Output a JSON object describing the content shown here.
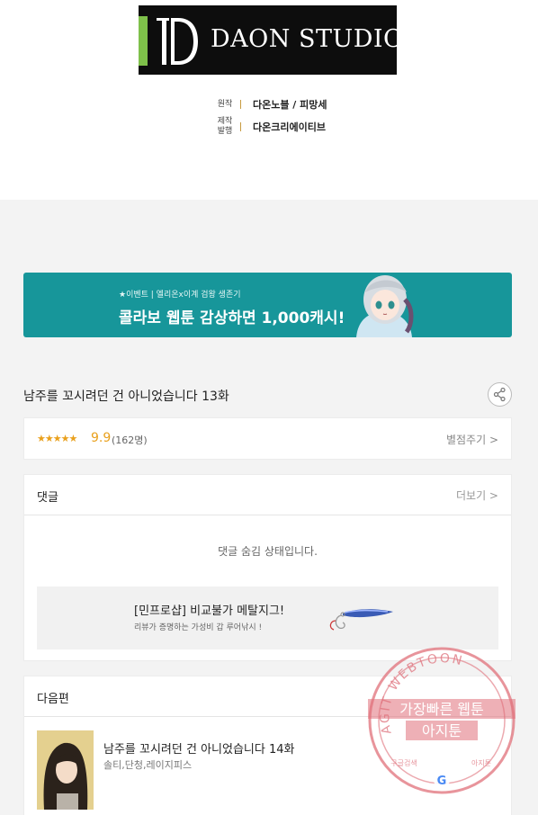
{
  "header": {
    "logo_text": "DAON STUDIO",
    "credits": [
      {
        "key": "원작",
        "value": "다온노블 / 피망세"
      },
      {
        "key": "제작\n발행",
        "value": "다온크리에이티브"
      }
    ]
  },
  "banner": {
    "small_text": "★이벤트 | 엘리온x이계 검왕 생존기",
    "big_text": "콜라보 웹툰 감상하면 1,000캐시!"
  },
  "episode": {
    "title": "남주를 꼬시려던 건 아니었습니다 13화"
  },
  "rating": {
    "stars": "★★★★★",
    "score": "9.9",
    "count": "(162명)",
    "rate_label": "별점주기 >"
  },
  "comments": {
    "title": "댓글",
    "more_label": "더보기 >",
    "hidden_message": "댓글 숨김 상태입니다."
  },
  "ad": {
    "title": "[민프로샵] 비교불가 메탈지그!",
    "subtitle": "리뷰가 증명하는 가성비 갑 루어낚시 !"
  },
  "next": {
    "title": "다음편",
    "item_title": "남주를 꼬시려던 건 아니었습니다 14화",
    "item_authors": "솔티,단청,레이지피스"
  },
  "watermark": {
    "ring_text": "AGIT WEBTOON",
    "line1": "가장빠른 웹툰",
    "line2": "아지툰",
    "bottom_left": "구글검색",
    "bottom_right": "아지툰",
    "logo_letter": "G"
  },
  "colors": {
    "accent_teal": "#17969a",
    "star_orange": "#e9a01c",
    "logo_green": "#7ec04a",
    "stamp_red": "#e0707a"
  }
}
